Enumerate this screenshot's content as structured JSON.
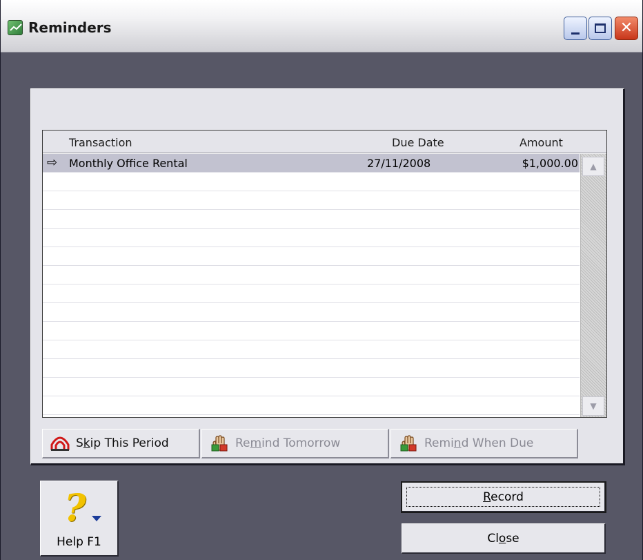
{
  "window": {
    "title": "Reminders",
    "minimize_label": "_",
    "maximize_label": "□",
    "close_label": "✕"
  },
  "list": {
    "columns": {
      "transaction": "Transaction",
      "due_date": "Due Date",
      "amount": "Amount"
    },
    "rows": [
      {
        "marker": "⇨",
        "transaction": "Monthly Office Rental",
        "due_date": "27/11/2008",
        "amount": "$1,000.00",
        "selected": true
      }
    ],
    "empty_row_count": 13
  },
  "actions": {
    "skip": {
      "pre": "S",
      "key": "k",
      "post": "ip This Period",
      "icon": "skip-period-icon",
      "enabled": true
    },
    "remind_tomorrow": {
      "pre": "Re",
      "key": "m",
      "post": "ind Tomorrow",
      "icon": "remind-hand-icon",
      "enabled": false
    },
    "remind_when_due": {
      "pre": "Remi",
      "key": "n",
      "post": "d When Due",
      "icon": "remind-hand-icon",
      "enabled": false
    }
  },
  "help": {
    "label": "Help F1",
    "icon": "help-question-icon"
  },
  "buttons": {
    "record": {
      "key": "R",
      "post": "ecord"
    },
    "close": {
      "pre": "Cl",
      "key": "o",
      "post": "se"
    }
  },
  "colors": {
    "window_background": "#575766",
    "panel_background": "#e4e4ea",
    "selected_row": "#c2c2d0",
    "help_question": "#f2c200"
  }
}
